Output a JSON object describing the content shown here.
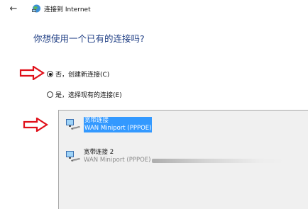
{
  "window": {
    "title": "连接到 Internet",
    "back_icon": "back-arrow-icon",
    "app_icon": "network-globe-icon"
  },
  "question": "你想使用一个已有的连接吗?",
  "options": [
    {
      "label": "否，创建新连接(C)",
      "checked": true
    },
    {
      "label": "是，选择现有的连接(E)",
      "checked": false
    }
  ],
  "connections": [
    {
      "name": "宽带连接",
      "device": "WAN Miniport (PPPOE)",
      "selected": true
    },
    {
      "name": "宽带连接 2",
      "device": "WAN Miniport (PPPOE)",
      "selected": false
    }
  ],
  "colors": {
    "accent": "#1f3e84",
    "selection": "#3399ff",
    "annotation_arrow": "#e0101a"
  }
}
